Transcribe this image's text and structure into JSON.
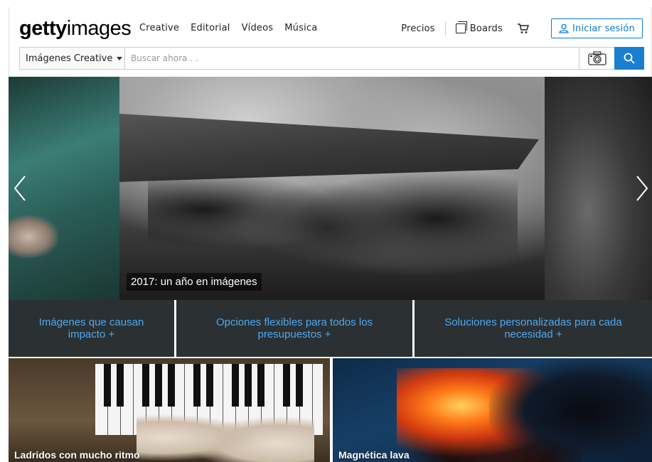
{
  "brand": {
    "bold": "getty",
    "light": "images"
  },
  "nav": {
    "items": [
      "Creative",
      "Editorial",
      "Vídeos",
      "Música"
    ]
  },
  "right_nav": {
    "pricing": "Precios",
    "boards": "Boards",
    "signin": "Iniciar sesión"
  },
  "search": {
    "category": "Imágenes Creative",
    "placeholder": "Buscar ahora . ."
  },
  "hero": {
    "caption": "2017: un año en imágenes"
  },
  "features": [
    {
      "label": "Imágenes que causan impacto +"
    },
    {
      "label": "Opciones flexibles para todos los presupuestos +"
    },
    {
      "label": "Soluciones personalizadas para cada necesidad +"
    }
  ],
  "tiles": [
    {
      "caption": "Ladridos con mucho ritmo"
    },
    {
      "caption": "Magnética lava"
    }
  ],
  "colors": {
    "accent": "#1a7fd0",
    "feature_text": "#4da9ef",
    "feature_bg": "#2b3033"
  }
}
